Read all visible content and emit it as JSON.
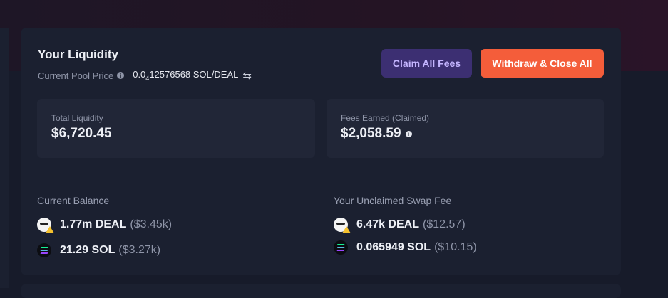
{
  "header": {
    "title": "Your Liquidity",
    "pool_price_label": "Current Pool Price",
    "pool_price_prefix": "0.0",
    "pool_price_zeros": "4",
    "pool_price_digits": "12576568 SOL/DEAL",
    "swap_icon_glyph": "⇆"
  },
  "actions": {
    "claim_label": "Claim All Fees",
    "withdraw_label": "Withdraw & Close All"
  },
  "stats": {
    "total_liquidity_label": "Total Liquidity",
    "total_liquidity_value": "$6,720.45",
    "fees_label": "Fees Earned (Claimed)",
    "fees_value": "$2,058.59"
  },
  "balance": {
    "label": "Current Balance",
    "items": [
      {
        "token": "DEAL",
        "amount": "1.77m DEAL",
        "usd": "($3.45k)",
        "icon": "deal-token-icon"
      },
      {
        "token": "SOL",
        "amount": "21.29 SOL",
        "usd": "($3.27k)",
        "icon": "sol-token-icon"
      }
    ]
  },
  "unclaimed": {
    "label": "Your Unclaimed Swap Fee",
    "items": [
      {
        "token": "DEAL",
        "amount": "6.47k DEAL",
        "usd": "($12.57)",
        "icon": "deal-token-icon"
      },
      {
        "token": "SOL",
        "amount": "0.065949 SOL",
        "usd": "($10.15)",
        "icon": "sol-token-icon"
      }
    ]
  },
  "colors": {
    "background": "#171b2a",
    "card": "#1b2030",
    "claim_button": "#3c2f72",
    "withdraw_button": "#f45d3a",
    "muted_text": "#8f95a8"
  }
}
